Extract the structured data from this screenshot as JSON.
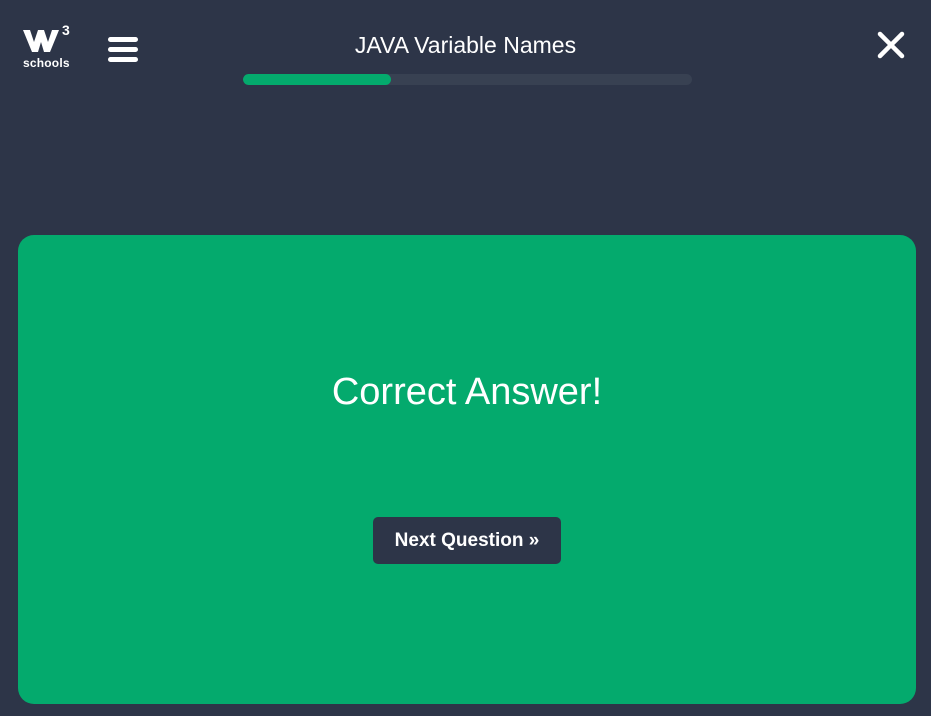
{
  "header": {
    "logo": {
      "superscript": "3",
      "text": "schools",
      "icon": "w3schools-logo-icon"
    },
    "menu_icon": "hamburger-menu-icon",
    "title": "JAVA Variable Names",
    "progress": 0.33,
    "close_icon": "close-icon"
  },
  "result": {
    "message": "Correct Answer!",
    "next_button_label": "Next Question »"
  },
  "colors": {
    "background": "#2d3548",
    "accent_green": "#04aa6d",
    "progress_track": "#384152",
    "text": "#ffffff"
  }
}
